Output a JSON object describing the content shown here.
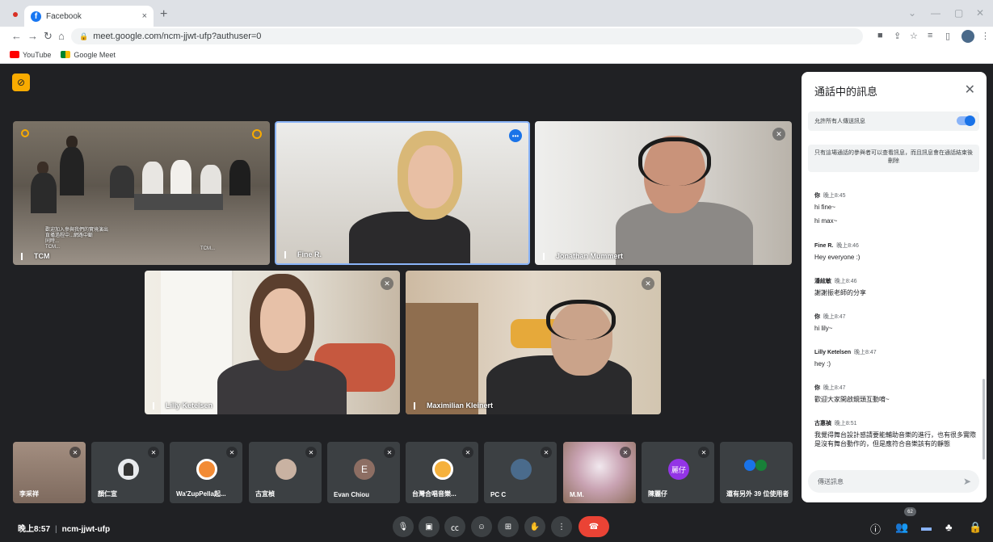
{
  "browser": {
    "tab_title": "Facebook",
    "tab_close": "×",
    "new_tab": "+",
    "url": "meet.google.com/ncm-jjwt-ufp?authuser=0",
    "bookmarks": [
      "YouTube",
      "Google Meet"
    ]
  },
  "participants_main": [
    {
      "name": "TCM",
      "overlay_left": "歡迎加入參與我們的實境演出\n直播過程中...網路中斷\n同時...\nTCM...",
      "overlay_right": "TCM..."
    },
    {
      "name": "Fine R."
    },
    {
      "name": "Jonathan Mummert"
    },
    {
      "name": "Lilly Ketelsen"
    },
    {
      "name": "Maximilian Kleinert"
    }
  ],
  "participants_strip": [
    {
      "name": "李采祥",
      "avatar": ""
    },
    {
      "name": "顏仁宣",
      "avatar": ""
    },
    {
      "name": "Wa'ZupPella起...",
      "avatar": ""
    },
    {
      "name": "古宜楨",
      "avatar": ""
    },
    {
      "name": "Evan Chiou",
      "avatar": "E"
    },
    {
      "name": "台灣合唱音樂...",
      "avatar": ""
    },
    {
      "name": "PC C",
      "avatar": ""
    },
    {
      "name": "M.M.",
      "avatar": ""
    },
    {
      "name": "陳麗仔",
      "avatar": "麗仔"
    },
    {
      "name": "還有另外 39 位使用者",
      "avatar": ""
    }
  ],
  "meeting": {
    "time": "晚上8:57",
    "separator": "|",
    "code": "ncm-jjwt-ufp",
    "participant_count": "62"
  },
  "chat": {
    "title": "通話中的訊息",
    "allow_label": "允許所有人傳送訊息",
    "notice": "只有這場通話的參與者可以查看訊息，而且訊息會在通話結束後刪除",
    "input_placeholder": "傳送訊息",
    "messages": [
      {
        "sender": "你",
        "time": "晚上8:45",
        "lines": [
          "hi fine~",
          "hi max~"
        ]
      },
      {
        "sender": "Fine R.",
        "time": "晚上8:46",
        "lines": [
          "Hey everyone :)"
        ]
      },
      {
        "sender": "潘絃敏",
        "time": "晚上8:46",
        "lines": [
          "謝謝振老師的分享"
        ]
      },
      {
        "sender": "你",
        "time": "晚上8:47",
        "lines": [
          "hi lily~"
        ]
      },
      {
        "sender": "Lilly Ketelsen",
        "time": "晚上8:47",
        "lines": [
          "hey :)"
        ]
      },
      {
        "sender": "你",
        "time": "晚上8:47",
        "lines": [
          "歡迎大家開啟鏡頭互動唷~"
        ]
      },
      {
        "sender": "古惠禎",
        "time": "晚上8:51",
        "lines": [
          "我覺得舞台設計感請要能輔助音樂的進行，也有很多實際是沒有舞台動作的，但是應符合音樂該有的靜態"
        ]
      }
    ]
  },
  "icons": {
    "mic": "mic-icon",
    "camera": "camera-icon",
    "captions": "captions-icon",
    "emoji": "emoji-icon",
    "present": "present-icon",
    "hand": "raise-hand-icon",
    "more": "more-icon",
    "hangup": "hangup-icon",
    "info": "info-icon",
    "people": "people-icon",
    "chat": "chat-icon",
    "activities": "activities-icon",
    "lock": "host-controls-icon"
  },
  "colors": {
    "meet_bg": "#202124",
    "hangup": "#ea4335",
    "accent": "#1a73e8",
    "active_border": "#8ab4f8"
  }
}
